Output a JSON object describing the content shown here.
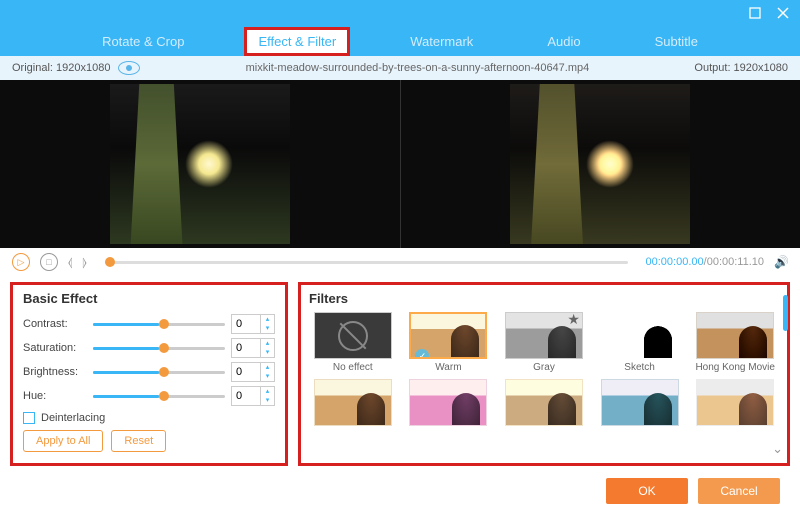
{
  "tabs": [
    "Rotate & Crop",
    "Effect & Filter",
    "Watermark",
    "Audio",
    "Subtitle"
  ],
  "activeTab": 1,
  "info": {
    "originalLabel": "Original: 1920x1080",
    "filename": "mixkit-meadow-surrounded-by-trees-on-a-sunny-afternoon-40647.mp4",
    "outputLabel": "Output: 1920x1080"
  },
  "playback": {
    "current": "00:00:00.00",
    "total": "00:00:11.10"
  },
  "basic": {
    "heading": "Basic Effect",
    "rows": [
      {
        "label": "Contrast:",
        "value": "0"
      },
      {
        "label": "Saturation:",
        "value": "0"
      },
      {
        "label": "Brightness:",
        "value": "0"
      },
      {
        "label": "Hue:",
        "value": "0"
      }
    ],
    "deinterlacing": "Deinterlacing",
    "applyAll": "Apply to All",
    "reset": "Reset"
  },
  "filters": {
    "heading": "Filters",
    "items": [
      {
        "label": "No effect",
        "kind": "none"
      },
      {
        "label": "Warm",
        "kind": "warm",
        "selected": true
      },
      {
        "label": "Gray",
        "kind": "gray",
        "star": true
      },
      {
        "label": "Sketch",
        "kind": "sketch"
      },
      {
        "label": "Hong Kong Movie",
        "kind": "hk"
      },
      {
        "label": "",
        "kind": "warm2"
      },
      {
        "label": "",
        "kind": "mask"
      },
      {
        "label": "",
        "kind": "old"
      },
      {
        "label": "",
        "kind": "cool"
      },
      {
        "label": "",
        "kind": "over"
      }
    ]
  },
  "footer": {
    "ok": "OK",
    "cancel": "Cancel"
  }
}
